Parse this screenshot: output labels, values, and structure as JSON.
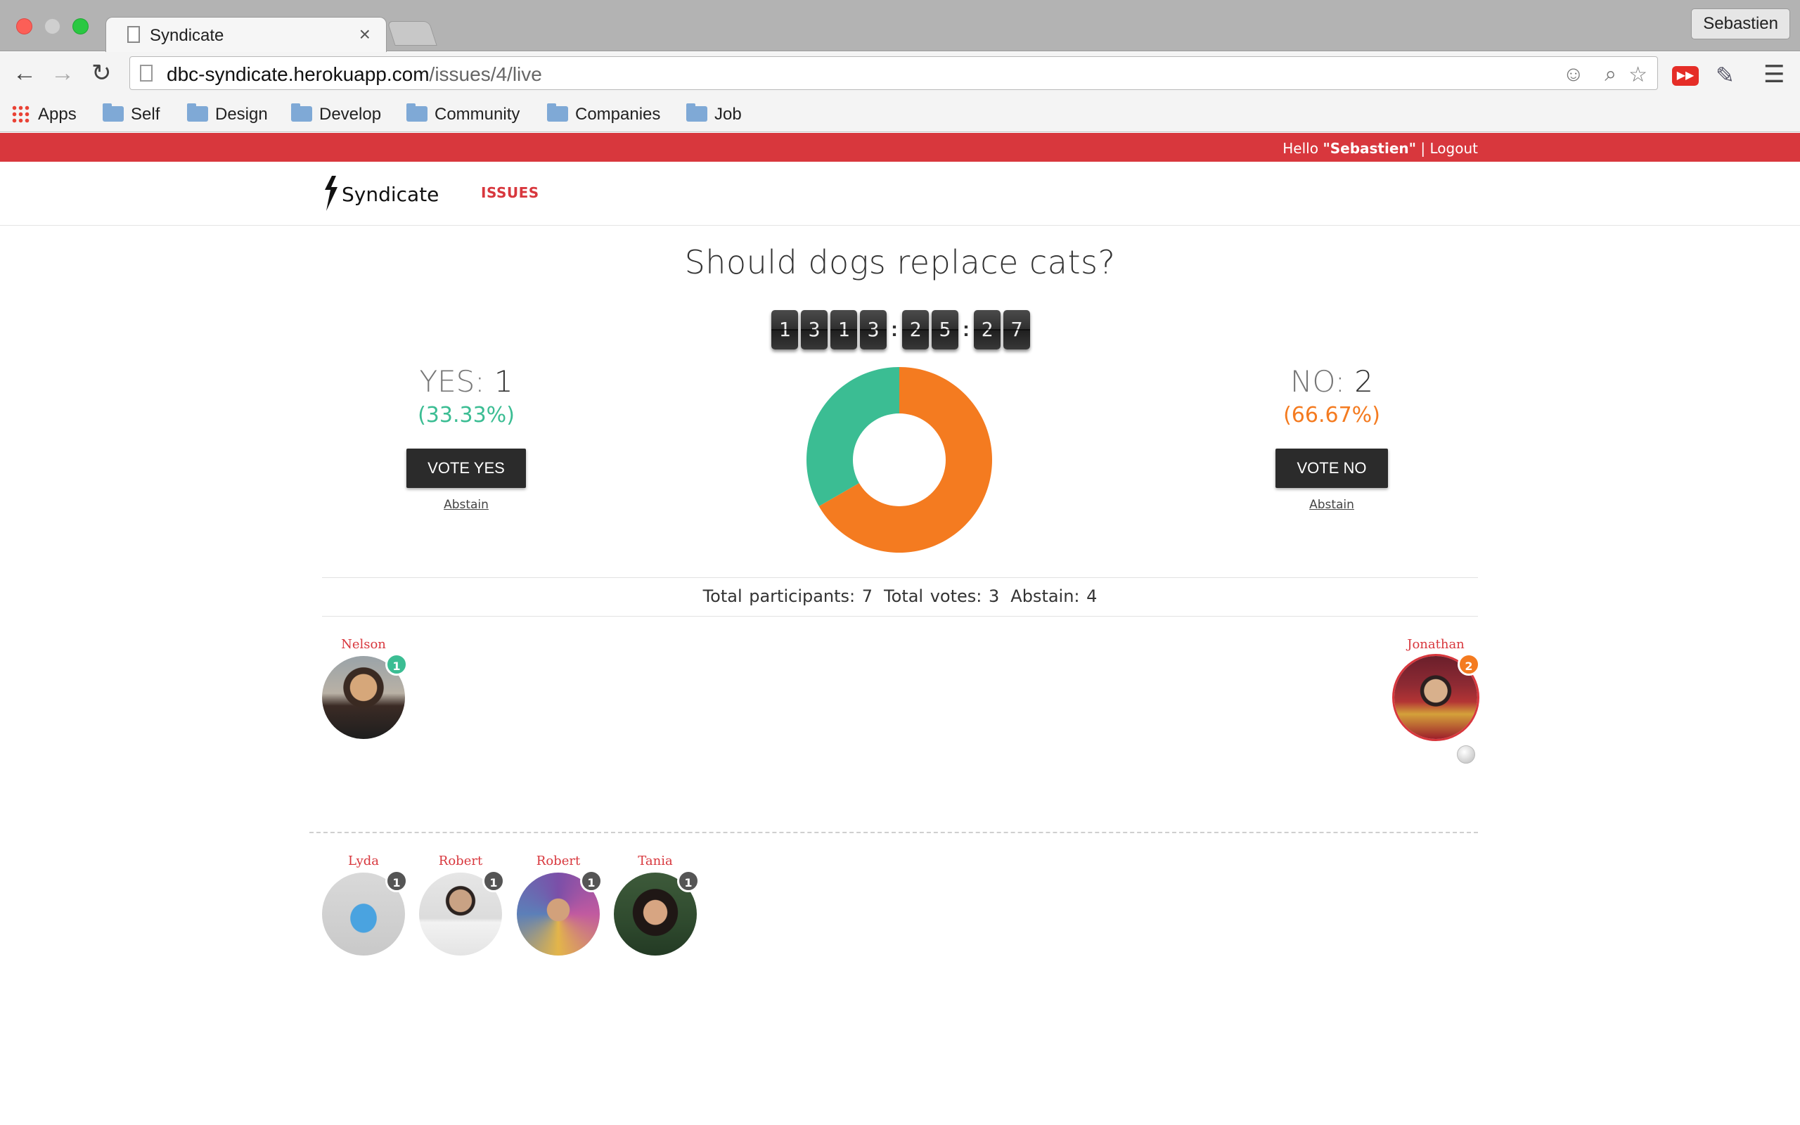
{
  "browser": {
    "tab_title": "Syndicate",
    "tab_close": "×",
    "profile_name": "Sebastien",
    "url_host": "dbc-syndicate.herokuapp.com",
    "url_path": "/issues/4/live",
    "bookmarks": [
      "Apps",
      "Self",
      "Design",
      "Develop",
      "Community",
      "Companies",
      "Job"
    ]
  },
  "topbar": {
    "hello_prefix": "Hello ",
    "user": "\"Sebastien\"",
    "separator": " | ",
    "logout": "Logout"
  },
  "nav": {
    "brand": "Syndicate",
    "issues": "ISSUES"
  },
  "issue": {
    "question": "Should dogs replace cats?",
    "countdown": [
      "1",
      "3",
      "1",
      "3",
      ":",
      "2",
      "5",
      ":",
      "2",
      "7"
    ]
  },
  "yes": {
    "label": "YES: ",
    "count": "1",
    "percent": "(33.33%)",
    "button": "VOTE YES",
    "abstain": "Abstain"
  },
  "no": {
    "label": "NO: ",
    "count": "2",
    "percent": "(66.67%)",
    "button": "VOTE NO",
    "abstain": "Abstain"
  },
  "chart_data": {
    "type": "pie",
    "categories": [
      "YES",
      "NO"
    ],
    "values": [
      1,
      2
    ],
    "colors": [
      "#3bbd93",
      "#f47b20"
    ]
  },
  "stats": {
    "participants": "Total participants: 7",
    "votes": "Total votes: 3",
    "abstain": "Abstain: 4"
  },
  "voters_yes": [
    {
      "name": "Nelson",
      "badge": "1"
    }
  ],
  "voters_no": [
    {
      "name": "Jonathan",
      "badge": "2"
    }
  ],
  "abstainers": [
    {
      "name": "Lyda",
      "badge": "1"
    },
    {
      "name": "Robert",
      "badge": "1"
    },
    {
      "name": "Robert",
      "badge": "1"
    },
    {
      "name": "Tania",
      "badge": "1"
    }
  ],
  "colors": {
    "brand_red": "#d8373d",
    "yes_green": "#3bbd93",
    "no_orange": "#f47b20",
    "button_dark": "#2b2b2b"
  }
}
